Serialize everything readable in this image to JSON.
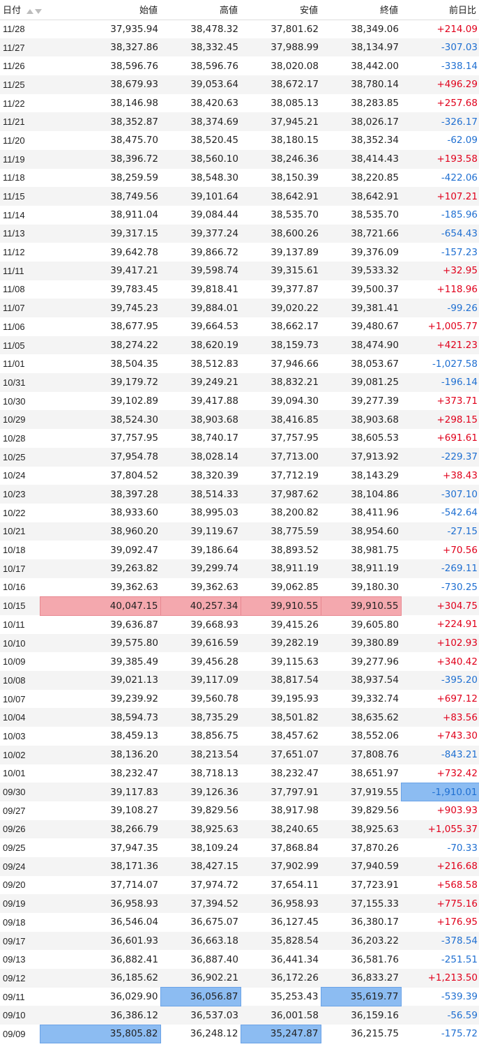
{
  "header": {
    "date": "日付",
    "open": "始値",
    "high": "高値",
    "low": "安値",
    "close": "終値",
    "change": "前日比"
  },
  "rows": [
    [
      "11/28",
      "37,935.94",
      "38,478.32",
      "37,801.62",
      "38,349.06",
      "+214.09"
    ],
    [
      "11/27",
      "38,327.86",
      "38,332.45",
      "37,988.99",
      "38,134.97",
      "-307.03"
    ],
    [
      "11/26",
      "38,596.76",
      "38,596.76",
      "38,020.08",
      "38,442.00",
      "-338.14"
    ],
    [
      "11/25",
      "38,679.93",
      "39,053.64",
      "38,672.17",
      "38,780.14",
      "+496.29"
    ],
    [
      "11/22",
      "38,146.98",
      "38,420.63",
      "38,085.13",
      "38,283.85",
      "+257.68"
    ],
    [
      "11/21",
      "38,352.87",
      "38,374.69",
      "37,945.21",
      "38,026.17",
      "-326.17"
    ],
    [
      "11/20",
      "38,475.70",
      "38,520.45",
      "38,180.15",
      "38,352.34",
      "-62.09"
    ],
    [
      "11/19",
      "38,396.72",
      "38,560.10",
      "38,246.36",
      "38,414.43",
      "+193.58"
    ],
    [
      "11/18",
      "38,259.59",
      "38,548.30",
      "38,150.39",
      "38,220.85",
      "-422.06"
    ],
    [
      "11/15",
      "38,749.56",
      "39,101.64",
      "38,642.91",
      "38,642.91",
      "+107.21"
    ],
    [
      "11/14",
      "38,911.04",
      "39,084.44",
      "38,535.70",
      "38,535.70",
      "-185.96"
    ],
    [
      "11/13",
      "39,317.15",
      "39,377.24",
      "38,600.26",
      "38,721.66",
      "-654.43"
    ],
    [
      "11/12",
      "39,642.78",
      "39,866.72",
      "39,137.89",
      "39,376.09",
      "-157.23"
    ],
    [
      "11/11",
      "39,417.21",
      "39,598.74",
      "39,315.61",
      "39,533.32",
      "+32.95"
    ],
    [
      "11/08",
      "39,783.45",
      "39,818.41",
      "39,377.87",
      "39,500.37",
      "+118.96"
    ],
    [
      "11/07",
      "39,745.23",
      "39,884.01",
      "39,020.22",
      "39,381.41",
      "-99.26"
    ],
    [
      "11/06",
      "38,677.95",
      "39,664.53",
      "38,662.17",
      "39,480.67",
      "+1,005.77"
    ],
    [
      "11/05",
      "38,274.22",
      "38,620.19",
      "38,159.73",
      "38,474.90",
      "+421.23"
    ],
    [
      "11/01",
      "38,504.35",
      "38,512.83",
      "37,946.66",
      "38,053.67",
      "-1,027.58"
    ],
    [
      "10/31",
      "39,179.72",
      "39,249.21",
      "38,832.21",
      "39,081.25",
      "-196.14"
    ],
    [
      "10/30",
      "39,102.89",
      "39,417.88",
      "39,094.30",
      "39,277.39",
      "+373.71"
    ],
    [
      "10/29",
      "38,524.30",
      "38,903.68",
      "38,416.85",
      "38,903.68",
      "+298.15"
    ],
    [
      "10/28",
      "37,757.95",
      "38,740.17",
      "37,757.95",
      "38,605.53",
      "+691.61"
    ],
    [
      "10/25",
      "37,954.78",
      "38,028.14",
      "37,713.00",
      "37,913.92",
      "-229.37"
    ],
    [
      "10/24",
      "37,804.52",
      "38,320.39",
      "37,712.19",
      "38,143.29",
      "+38.43"
    ],
    [
      "10/23",
      "38,397.28",
      "38,514.33",
      "37,987.62",
      "38,104.86",
      "-307.10"
    ],
    [
      "10/22",
      "38,933.60",
      "38,995.03",
      "38,200.82",
      "38,411.96",
      "-542.64"
    ],
    [
      "10/21",
      "38,960.20",
      "39,119.67",
      "38,775.59",
      "38,954.60",
      "-27.15"
    ],
    [
      "10/18",
      "39,092.47",
      "39,186.64",
      "38,893.52",
      "38,981.75",
      "+70.56"
    ],
    [
      "10/17",
      "39,263.82",
      "39,299.74",
      "38,911.19",
      "38,911.19",
      "-269.11"
    ],
    [
      "10/16",
      "39,362.63",
      "39,362.63",
      "39,062.85",
      "39,180.30",
      "-730.25"
    ],
    [
      "10/15",
      "40,047.15",
      "40,257.34",
      "39,910.55",
      "39,910.55",
      "+304.75"
    ],
    [
      "10/11",
      "39,636.87",
      "39,668.93",
      "39,415.26",
      "39,605.80",
      "+224.91"
    ],
    [
      "10/10",
      "39,575.80",
      "39,616.59",
      "39,282.19",
      "39,380.89",
      "+102.93"
    ],
    [
      "10/09",
      "39,385.49",
      "39,456.28",
      "39,115.63",
      "39,277.96",
      "+340.42"
    ],
    [
      "10/08",
      "39,021.13",
      "39,117.09",
      "38,817.54",
      "38,937.54",
      "-395.20"
    ],
    [
      "10/07",
      "39,239.92",
      "39,560.78",
      "39,195.93",
      "39,332.74",
      "+697.12"
    ],
    [
      "10/04",
      "38,594.73",
      "38,735.29",
      "38,501.82",
      "38,635.62",
      "+83.56"
    ],
    [
      "10/03",
      "38,459.13",
      "38,856.75",
      "38,457.62",
      "38,552.06",
      "+743.30"
    ],
    [
      "10/02",
      "38,136.20",
      "38,213.54",
      "37,651.07",
      "37,808.76",
      "-843.21"
    ],
    [
      "10/01",
      "38,232.47",
      "38,718.13",
      "38,232.47",
      "38,651.97",
      "+732.42"
    ],
    [
      "09/30",
      "39,117.83",
      "39,126.36",
      "37,797.91",
      "37,919.55",
      "-1,910.01"
    ],
    [
      "09/27",
      "39,108.27",
      "39,829.56",
      "38,917.98",
      "39,829.56",
      "+903.93"
    ],
    [
      "09/26",
      "38,266.79",
      "38,925.63",
      "38,240.65",
      "38,925.63",
      "+1,055.37"
    ],
    [
      "09/25",
      "37,947.35",
      "38,109.24",
      "37,868.84",
      "37,870.26",
      "-70.33"
    ],
    [
      "09/24",
      "38,171.36",
      "38,427.15",
      "37,902.99",
      "37,940.59",
      "+216.68"
    ],
    [
      "09/20",
      "37,714.07",
      "37,974.72",
      "37,654.11",
      "37,723.91",
      "+568.58"
    ],
    [
      "09/19",
      "36,958.93",
      "37,394.52",
      "36,958.93",
      "37,155.33",
      "+775.16"
    ],
    [
      "09/18",
      "36,546.04",
      "36,675.07",
      "36,127.45",
      "36,380.17",
      "+176.95"
    ],
    [
      "09/17",
      "36,601.93",
      "36,663.18",
      "35,828.54",
      "36,203.22",
      "-378.54"
    ],
    [
      "09/13",
      "36,882.41",
      "36,887.40",
      "36,441.34",
      "36,581.76",
      "-251.51"
    ],
    [
      "09/12",
      "36,185.62",
      "36,902.21",
      "36,172.26",
      "36,833.27",
      "+1,213.50"
    ],
    [
      "09/11",
      "36,029.90",
      "36,056.87",
      "35,253.43",
      "35,619.77",
      "-539.39"
    ],
    [
      "09/10",
      "36,386.12",
      "36,537.03",
      "36,001.58",
      "36,159.16",
      "-56.59"
    ],
    [
      "09/09",
      "35,805.82",
      "36,248.12",
      "35,247.87",
      "36,215.75",
      "-175.72"
    ]
  ],
  "highlights": [
    {
      "row": 31,
      "col": 1,
      "color": "red"
    },
    {
      "row": 31,
      "col": 2,
      "color": "red"
    },
    {
      "row": 31,
      "col": 3,
      "color": "red"
    },
    {
      "row": 31,
      "col": 4,
      "color": "red"
    },
    {
      "row": 41,
      "col": 5,
      "color": "blue"
    },
    {
      "row": 52,
      "col": 2,
      "color": "blue"
    },
    {
      "row": 52,
      "col": 4,
      "color": "blue"
    },
    {
      "row": 54,
      "col": 1,
      "color": "blue"
    },
    {
      "row": 54,
      "col": 3,
      "color": "blue"
    }
  ],
  "colors": {
    "positive": "#e0001b",
    "negative": "#1f6fd1",
    "highlight_red": "#f4a8ae",
    "highlight_blue": "#8cbcf2"
  },
  "icons": {
    "sort_asc": "sort-ascending-icon",
    "sort_desc": "sort-descending-icon"
  }
}
